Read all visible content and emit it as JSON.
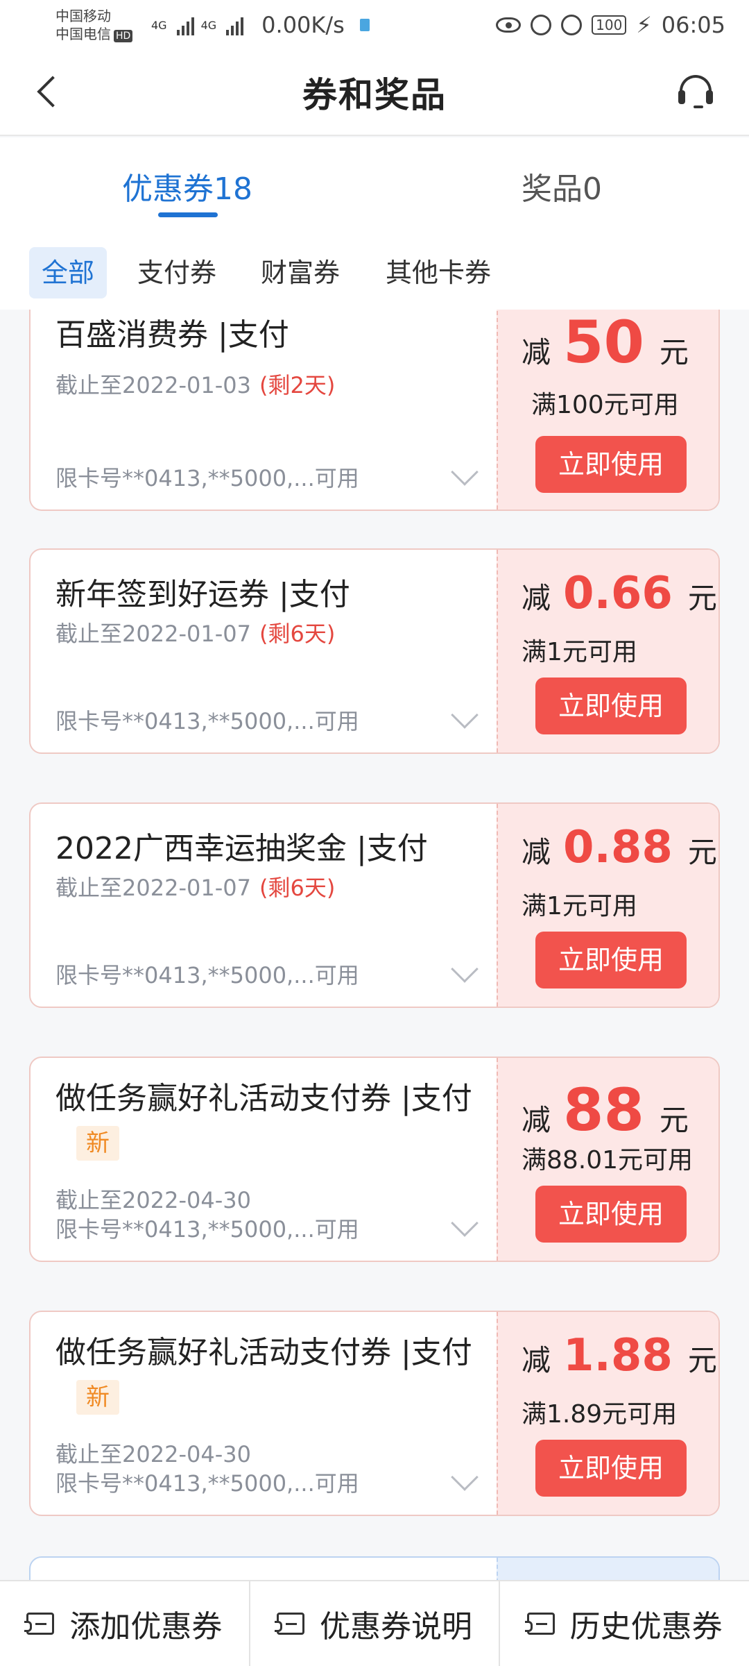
{
  "status_bar": {
    "carrier1": "中国移动",
    "carrier2": "中国电信",
    "hd": "HD",
    "net1": "4G",
    "net2": "4G",
    "speed": "0.00K/s",
    "battery": "100",
    "time": "06:05"
  },
  "header": {
    "title": "券和奖品"
  },
  "tabs": [
    {
      "label": "优惠券18",
      "active": true
    },
    {
      "label": "奖品0",
      "active": false
    }
  ],
  "filters": [
    {
      "label": "全部",
      "active": true
    },
    {
      "label": "支付券"
    },
    {
      "label": "财富券"
    },
    {
      "label": "其他卡券"
    }
  ],
  "coupons": [
    {
      "title": "百盛消费券 |支付",
      "expiry": "截止至2022-01-03",
      "remain": "(剩2天)",
      "limit": "限卡号**0413,**5000,...可用",
      "minus": "减",
      "amount": "50",
      "unit": "元",
      "condition": "满100元可用",
      "button": "立即使用"
    },
    {
      "title": "新年签到好运券 |支付",
      "expiry": "截止至2022-01-07",
      "remain": "(剩6天)",
      "limit": "限卡号**0413,**5000,...可用",
      "minus": "减",
      "amount": "0.66",
      "unit": "元",
      "condition": "满1元可用",
      "button": "立即使用"
    },
    {
      "title": "2022广西幸运抽奖金 |支付",
      "expiry": "截止至2022-01-07",
      "remain": "(剩6天)",
      "limit": "限卡号**0413,**5000,...可用",
      "minus": "减",
      "amount": "0.88",
      "unit": "元",
      "condition": "满1元可用",
      "button": "立即使用"
    },
    {
      "title": "做任务赢好礼活动支付券 |支付",
      "badge": "新",
      "expiry": "截止至2022-04-30",
      "limit": "限卡号**0413,**5000,...可用",
      "minus": "减",
      "amount": "88",
      "unit": "元",
      "condition": "满88.01元可用",
      "button": "立即使用"
    },
    {
      "title": "做任务赢好礼活动支付券 |支付",
      "badge": "新",
      "expiry": "截止至2022-04-30",
      "limit": "限卡号**0413,**5000,...可用",
      "minus": "减",
      "amount": "1.88",
      "unit": "元",
      "condition": "满1.89元可用",
      "button": "立即使用"
    }
  ],
  "bottom_bar": [
    {
      "label": "添加优惠券",
      "icon": "add-coupon-icon"
    },
    {
      "label": "优惠券说明",
      "icon": "coupon-info-icon"
    },
    {
      "label": "历史优惠券",
      "icon": "coupon-history-icon"
    }
  ],
  "colors": {
    "accent": "#1f73d3",
    "price_red": "#ef4a44",
    "button_red": "#f2534d",
    "coupon_pink": "#fde7e6",
    "badge_orange": "#f08a24"
  }
}
